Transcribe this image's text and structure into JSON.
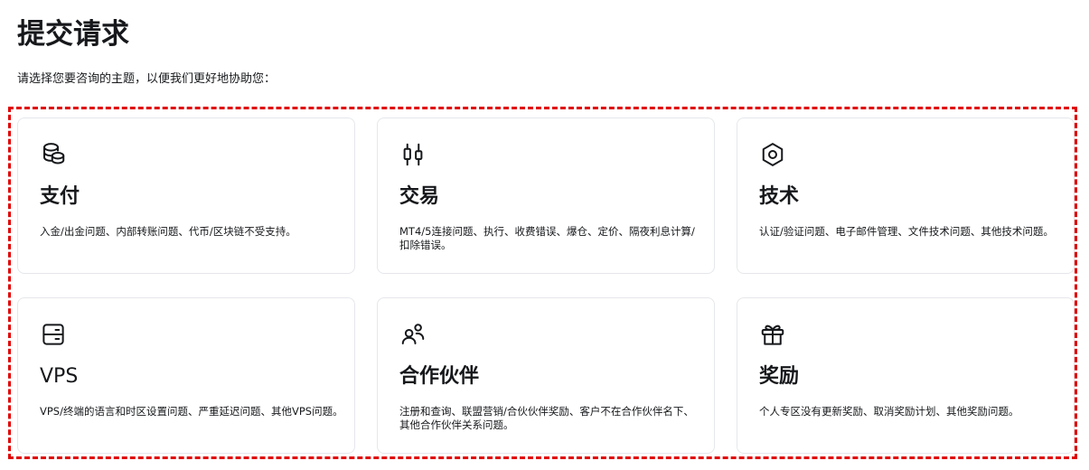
{
  "header": {
    "title": "提交请求",
    "intro": "请选择您要咨询的主题，以便我们更好地协助您："
  },
  "accent_colors": {
    "frame": "#e00000",
    "card_border": "#e5e7eb",
    "text": "#16181b"
  },
  "categories": [
    {
      "icon": "coins-icon",
      "title": "支付",
      "description": "入金/出金问题、内部转账问题、代币/区块链不受支持。"
    },
    {
      "icon": "candlestick-icon",
      "title": "交易",
      "description": "MT4/5连接问题、执行、收费错误、爆仓、定价、隔夜利息计算/扣除错误。"
    },
    {
      "icon": "hexagon-nut-icon",
      "title": "技术",
      "description": "认证/验证问题、电子邮件管理、文件技术问题、其他技术问题。"
    },
    {
      "icon": "server-icon",
      "title": "VPS",
      "description": "VPS/终端的语言和时区设置问题、严重延迟问题、其他VPS问题。"
    },
    {
      "icon": "users-icon",
      "title": "合作伙伴",
      "description": "注册和查询、联盟营销/合伙伙伴奖励、客户不在合作伙伴名下、其他合作伙伴关系问题。"
    },
    {
      "icon": "gift-icon",
      "title": "奖励",
      "description": "个人专区没有更新奖励、取消奖励计划、其他奖励问题。"
    }
  ]
}
